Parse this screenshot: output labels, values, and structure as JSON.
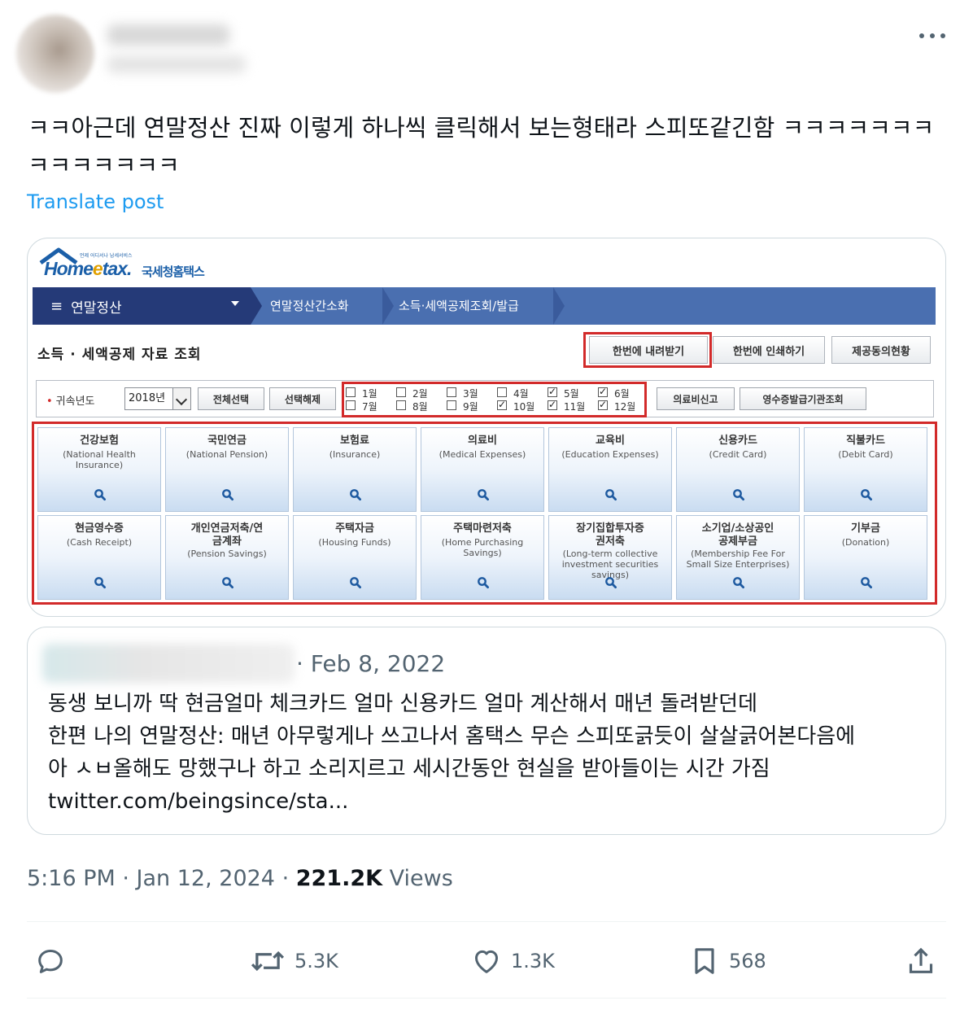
{
  "tweet": {
    "text": "ㅋㅋ아근데 연말정산 진짜 이렇게 하나씩 클릭해서 보는형태라 스피또같긴함 ㅋㅋㅋㅋㅋㅋㅋㅋㅋㅋㅋㅋㅋㅋ",
    "translate_label": "Translate post",
    "time": "5:16 PM",
    "date": "Jan 12, 2024",
    "views_count": "221.2K",
    "views_label": "Views"
  },
  "hometax": {
    "logo_main": "Home",
    "logo_e": "e",
    "logo_tax": "tax.",
    "logo_sub": "국세청홈택스",
    "logo_tiny": "언제 어디서나 납세서비스",
    "nav": {
      "menu": "연말정산",
      "crumb1": "연말정산간소화",
      "crumb2": "소득·세액공제조회/발급"
    },
    "page_title": "소득 · 세액공제 자료 조회",
    "buttons": {
      "download_all": "한번에 내려받기",
      "print_all": "한번에 인쇄하기",
      "consent_status": "제공동의현황"
    },
    "filter": {
      "year_label": "귀속년도",
      "year_value": "2018년",
      "select_all": "전체선택",
      "deselect": "선택해제",
      "medical_report": "의료비신고",
      "receipt_org": "영수증발급기관조회",
      "months": [
        {
          "label": "1월",
          "checked": false
        },
        {
          "label": "7월",
          "checked": false
        },
        {
          "label": "2월",
          "checked": false
        },
        {
          "label": "8월",
          "checked": false
        },
        {
          "label": "3월",
          "checked": false
        },
        {
          "label": "9월",
          "checked": false
        },
        {
          "label": "4월",
          "checked": false
        },
        {
          "label": "10월",
          "checked": true
        },
        {
          "label": "5월",
          "checked": true
        },
        {
          "label": "11월",
          "checked": true
        },
        {
          "label": "6월",
          "checked": true
        },
        {
          "label": "12월",
          "checked": true
        }
      ]
    },
    "categories": [
      {
        "ko": "건강보험",
        "en": "(National Health Insurance)"
      },
      {
        "ko": "국민연금",
        "en": "(National Pension)"
      },
      {
        "ko": "보험료",
        "en": "(Insurance)"
      },
      {
        "ko": "의료비",
        "en": "(Medical Expenses)"
      },
      {
        "ko": "교육비",
        "en": "(Education Expenses)"
      },
      {
        "ko": "신용카드",
        "en": "(Credit Card)"
      },
      {
        "ko": "직불카드",
        "en": "(Debit Card)"
      },
      {
        "ko": "현금영수증",
        "en": "(Cash Receipt)"
      },
      {
        "ko": "개인연금저축/연금계좌",
        "en": "(Pension Savings)"
      },
      {
        "ko": "주택자금",
        "en": "(Housing Funds)"
      },
      {
        "ko": "주택마련저축",
        "en": "(Home Purchasing Savings)"
      },
      {
        "ko": "장기집합투자증권저축",
        "en": "(Long-term collective investment securities savings)"
      },
      {
        "ko": "소기업/소상공인공제부금",
        "en": "(Membership Fee For Small Size Enterprises)"
      },
      {
        "ko": "기부금",
        "en": "(Donation)"
      }
    ]
  },
  "quote": {
    "date": "· Feb 8, 2022",
    "line1": "동생 보니까 딱 현금얼마 체크카드 얼마 신용카드 얼마 계산해서 매년 돌려받던데",
    "line2": "한편 나의 연말정산: 매년 아무렇게나 쓰고나서 홈택스 무슨 스피또긁듯이 살살긁어본다음에",
    "line3": "아 ㅅㅂ올해도 망했구나 하고 소리지르고 세시간동안 현실을 받아들이는 시간 가짐",
    "link": "twitter.com/beingsince/sta..."
  },
  "actions": {
    "reply_icon": "reply-icon",
    "retweet_count": "5.3K",
    "like_count": "1.3K",
    "bookmark_count": "568"
  },
  "colors": {
    "accent": "#1d9bf0",
    "hometax_nav_dark": "#253a78",
    "hometax_nav": "#4a6fb0",
    "highlight_red": "#d22a2a"
  }
}
